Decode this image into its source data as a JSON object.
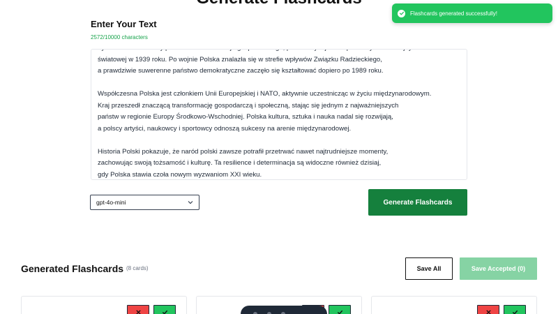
{
  "page": {
    "title": "Generate Flashcards"
  },
  "toast": {
    "message": "Flashcards generated successfully!",
    "color": "#22c55e"
  },
  "input": {
    "label": "Enter Your Text",
    "char_count": "2572/10000 characters",
    "paragraphs": [
      [
        "był czasem odbudowy państwowości i rozwoju gospodarczego, przerwanym jednak przez wybuch II wojny",
        "światowej w 1939 roku. Po wojnie Polska znalazła się w strefie wpływów Związku Radzieckiego,",
        "a prawdziwie suwerenne państwo demokratyczne zaczęło się kształtować dopiero po 1989 roku."
      ],
      [
        "Współczesna Polska jest członkiem Unii Europejskiej i NATO, aktywnie uczestnicząc w życiu międzynarodowym.",
        "Kraj przeszedł znaczącą transformację gospodarczą i społeczną, stając się jednym z najważniejszych",
        "państw w regionie Europy Środkowo-Wschodniej. Polska kultura, sztuka i nauka nadal się rozwijają,",
        "a polscy artyści, naukowcy i sportowcy odnoszą sukcesy na arenie międzynarodowej."
      ],
      [
        "Historia Polski pokazuje, że naród polski zawsze potrafił przetrwać nawet najtrudniejsze momenty,",
        "zachowując swoją tożsamość i kulturę. Ta resilience i determinacja są widoczne również dzisiaj,",
        "gdy Polska stawia czoła nowym wyzwaniom XXI wieku."
      ]
    ]
  },
  "model_select": {
    "selected": "gpt-4o-mini"
  },
  "generate_button": {
    "label": "Generate Flashcards"
  },
  "flashcards": {
    "title": "Generated Flashcards",
    "count_label": "(8 cards)",
    "save_all_label": "Save All",
    "save_accepted_label": "Save Accepted (0)"
  },
  "colors": {
    "primary": "#15803d",
    "success": "#22c55e",
    "danger": "#ef4444",
    "disabled": "#86d3a4"
  }
}
